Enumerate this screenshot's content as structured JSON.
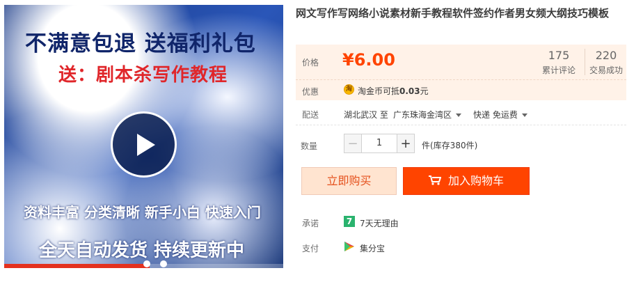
{
  "media": {
    "line1": "不满意包退 送福利礼包",
    "line2": "送：剧本杀写作教程",
    "line3": "资料丰富 分类清晰 新手小白 快速入门",
    "line4": "全天自动发货 持续更新中",
    "play_icon": "play-icon",
    "progress_fraction": 0.52,
    "overlay_color": "#1d3f8e"
  },
  "product": {
    "title": "网文写作写网络小说素材新手教程软件签约作者男女频大纲技巧模板"
  },
  "price": {
    "label": "价格",
    "value": "¥6.00",
    "color": "#ff4400",
    "reviews_count": "175",
    "reviews_label": "累计评论",
    "sales_count": "220",
    "sales_label": "交易成功"
  },
  "promo": {
    "label": "优惠",
    "icon": "taojinbi-coin-icon",
    "text_prefix": "淘金币可抵",
    "text_amount": "0.03",
    "text_suffix": "元"
  },
  "shipping": {
    "label": "配送",
    "from": "湖北武汉 至",
    "to": "广东珠海金湾区",
    "method": "快递 免运费"
  },
  "quantity": {
    "label": "数量",
    "value": "1",
    "minus": "−",
    "plus": "+",
    "stock": "件(库存380件)"
  },
  "actions": {
    "buy_now": "立即购买",
    "add_to_cart": "加入购物车"
  },
  "promise": {
    "label": "承诺",
    "badge": "7",
    "text": "7天无理由"
  },
  "payment": {
    "label": "支付",
    "icon": "jifenbao-icon",
    "text": "集分宝"
  }
}
